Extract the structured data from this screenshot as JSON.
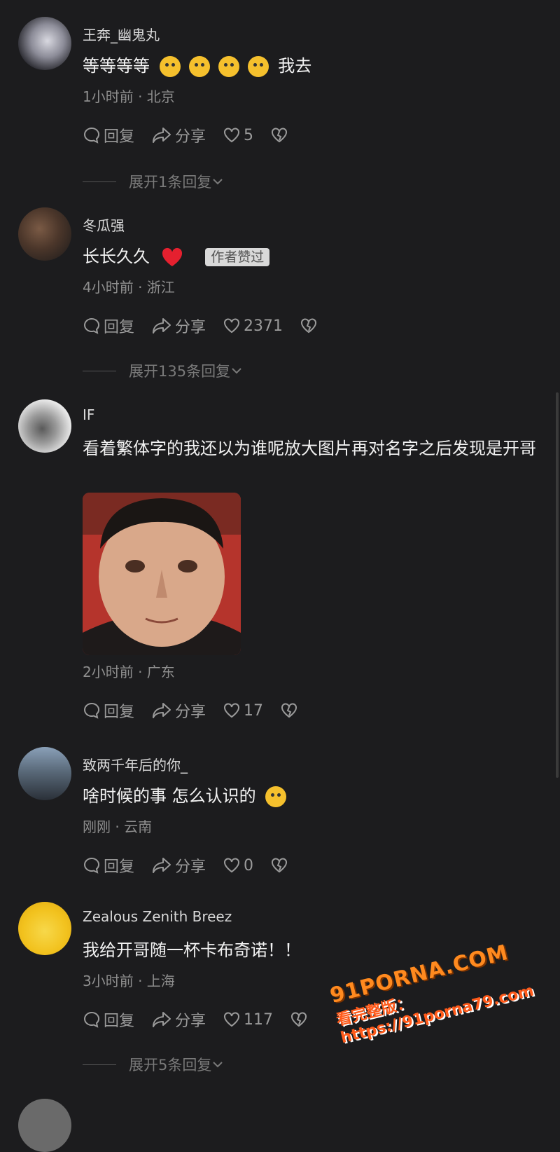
{
  "comments": [
    {
      "username": "王奔_幽鬼丸",
      "text_before": "等等等等",
      "text_after": "我去",
      "time_location": "1小时前 · 北京",
      "reply_label": "回复",
      "share_label": "分享",
      "likes": "5",
      "expand_label": "展开1条回复"
    },
    {
      "username": "冬瓜强",
      "text": "长长久久",
      "badge": "作者赞过",
      "time_location": "4小时前 · 浙江",
      "reply_label": "回复",
      "share_label": "分享",
      "likes": "2371",
      "expand_label": "展开135条回复"
    },
    {
      "username": "IF",
      "text": "看着繁体字的我还以为谁呢放大图片再对名字之后发现是开哥",
      "time_location": "2小时前 · 广东",
      "reply_label": "回复",
      "share_label": "分享",
      "likes": "17"
    },
    {
      "username": "致两千年后的你_",
      "text": "啥时候的事 怎么认识的",
      "time_location": "刚刚 · 云南",
      "reply_label": "回复",
      "share_label": "分享",
      "likes": "0"
    },
    {
      "username": "Zealous Zenith Breez",
      "text": "我给开哥随一杯卡布奇诺！！",
      "time_location": "3小时前 · 上海",
      "reply_label": "回复",
      "share_label": "分享",
      "likes": "117",
      "expand_label": "展开5条回复"
    }
  ],
  "watermark": {
    "line1": "91PORNA.COM",
    "line2": "看完整版：https://91porna79.com"
  },
  "colors": {
    "background": "#1c1c1e",
    "badge_bg": "#d9d9d9",
    "heart_red": "#e5202f",
    "watermark_orange": "#ff8a1f"
  },
  "icons": [
    "comment-bubble-icon",
    "share-arrow-icon",
    "heart-outline-icon",
    "broken-heart-icon",
    "chevron-down-icon"
  ]
}
